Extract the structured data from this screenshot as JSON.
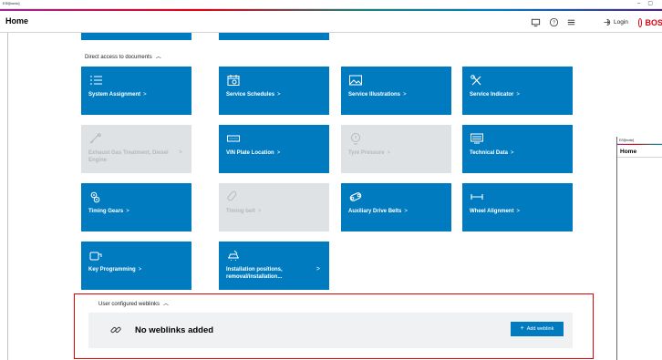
{
  "window": {
    "app_title": "ESI[tronic]",
    "minimize": "–",
    "maximize": "▢"
  },
  "header": {
    "title": "Home",
    "login_label": "Login",
    "brand": "BOSCH"
  },
  "sections": {
    "documents": {
      "label": "Direct access to documents"
    },
    "weblinks": {
      "label": "User configured weblinks",
      "empty_message": "No weblinks added",
      "add_button": "Add weblink"
    }
  },
  "tiles": [
    {
      "label": "System Assignment",
      "icon": "list-icon",
      "enabled": true
    },
    {
      "label": "Service Schedules",
      "icon": "calendar-gear-icon",
      "enabled": true
    },
    {
      "label": "Service Illustrations",
      "icon": "image-icon",
      "enabled": true
    },
    {
      "label": "Service Indicator",
      "icon": "wrench-screwdriver-icon",
      "enabled": true
    },
    {
      "label": "Exhaust Gas Treatment, Diesel Engine",
      "icon": "exhaust-icon",
      "enabled": false
    },
    {
      "label": "VIN Plate Location",
      "icon": "vin-plate-icon",
      "enabled": true
    },
    {
      "label": "Tyre Pressure",
      "icon": "tyre-pressure-icon",
      "enabled": false
    },
    {
      "label": "Technical Data",
      "icon": "tech-data-icon",
      "enabled": true
    },
    {
      "label": "Timing Gears",
      "icon": "gears-icon",
      "enabled": true
    },
    {
      "label": "Timing belt",
      "icon": "belt-icon",
      "enabled": false
    },
    {
      "label": "Auxiliary Drive Belts",
      "icon": "drive-belt-icon",
      "enabled": true
    },
    {
      "label": "Wheel Alignment",
      "icon": "wheel-alignment-icon",
      "enabled": true
    },
    {
      "label": "Key Programming",
      "icon": "key-icon",
      "enabled": true
    },
    {
      "label": "Installation positions, removal/installation...",
      "icon": "car-install-icon",
      "enabled": true
    }
  ],
  "overlay_window": {
    "app_title": "ESI[tronic]",
    "title": "Home"
  },
  "colors": {
    "tile_blue": "#007bc0",
    "tile_disabled": "#dfe2e4",
    "brand_red": "#e20015",
    "highlight_red": "#e00000"
  }
}
